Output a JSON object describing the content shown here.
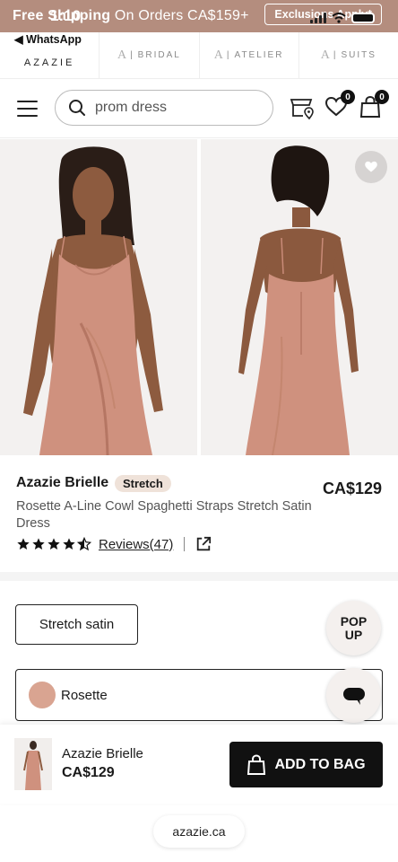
{
  "promo": {
    "bold": "Free Shipping",
    "rest": " On Orders CA$159+",
    "exclusions": "Exclusions Apply*"
  },
  "status": {
    "time": "1:10",
    "back_app": "◀ WhatsApp"
  },
  "brand_tabs": [
    {
      "label": "AZAZIE"
    },
    {
      "label": "BRIDAL"
    },
    {
      "label": "ATELIER"
    },
    {
      "label": "SUITS"
    }
  ],
  "header": {
    "search_value": "prom dress",
    "wishlist_count": "0",
    "bag_count": "0"
  },
  "product": {
    "name": "Azazie Brielle",
    "tag": "Stretch",
    "price": "CA$129",
    "description": "Rosette A-Line Cowl Spaghetti Straps Stretch Satin Dress",
    "rating": 4.5,
    "reviews": "Reviews(47)"
  },
  "options": {
    "fabric": "Stretch satin",
    "color": "Rosette",
    "color_hex": "#d9a491"
  },
  "widgets": {
    "popup_line1": "POP",
    "popup_line2": "UP"
  },
  "sticky": {
    "name": "Azazie Brielle",
    "price": "CA$129",
    "add_label": "ADD TO BAG"
  },
  "browser": {
    "url": "azazie.ca"
  },
  "colors": {
    "promo_bg": "#b48d7e",
    "dress": "#cf917e",
    "badge_bg": "#efe2d9",
    "button_bg": "#111111"
  }
}
